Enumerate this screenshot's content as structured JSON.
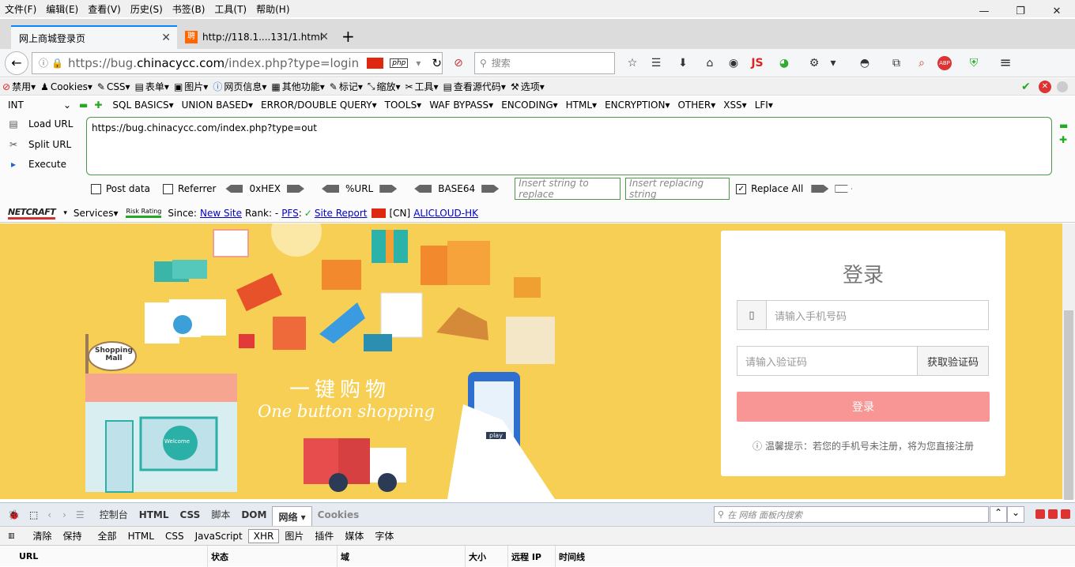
{
  "menubar": {
    "items": [
      "文件(F)",
      "编辑(E)",
      "查看(V)",
      "历史(S)",
      "书签(B)",
      "工具(T)",
      "帮助(H)"
    ]
  },
  "window": {
    "minimize": "—",
    "restore": "❐",
    "close": "✕"
  },
  "tabs": [
    {
      "title": "网上商城登录页"
    },
    {
      "title": "http://118.1....131/1.html"
    }
  ],
  "nav": {
    "url_prefix": "https://bug.",
    "url_domain": "chinacycc.com",
    "url_path": "/index.php?type=login",
    "search_placeholder": "搜索",
    "js_label": "JS",
    "php_label": "php"
  },
  "webdev": {
    "items": [
      "禁用▾",
      "Cookies▾",
      "CSS▾",
      "表单▾",
      "图片▾",
      "网页信息▾",
      "其他功能▾",
      "标记▾",
      "缩放▾",
      "工具▾",
      "查看源代码▾",
      "选项▾"
    ]
  },
  "hackbar": {
    "type_select": "INT",
    "menus": [
      "SQL BASICS▾",
      "UNION BASED▾",
      "ERROR/DOUBLE QUERY▾",
      "TOOLS▾",
      "WAF BYPASS▾",
      "ENCODING▾",
      "HTML▾",
      "ENCRYPTION▾",
      "OTHER▾",
      "XSS▾",
      "LFI▾"
    ],
    "load_url": "Load URL",
    "split_url": "Split URL",
    "execute": "Execute",
    "url_value": "https://bug.chinacycc.com/index.php?type=out",
    "post_data": "Post data",
    "referrer": "Referrer",
    "hex": "0xHEX",
    "url_enc": "%URL",
    "base64": "BASE64",
    "insert_placeholder": "Insert string to replace",
    "replacing_placeholder": "Insert replacing string",
    "replace_all": "Replace All",
    "replace_all_checked": true
  },
  "netcraft": {
    "logo": "NETCRAFT",
    "services": "Services▾",
    "risk": "Risk Rating",
    "since": "Since:",
    "since_val": "New Site",
    "rank": "Rank: -",
    "pfs": "PFS",
    "pfs_check": "✓",
    "site_report": "Site Report",
    "country": "[CN]",
    "host": "ALICLOUD-HK"
  },
  "page": {
    "slogan_cn": "一键购物",
    "slogan_en": "One button shopping",
    "mall_sign": "Shopping Mall",
    "welcome": "Welcome",
    "play": "play",
    "login": {
      "title": "登录",
      "phone_placeholder": "请输入手机号码",
      "code_placeholder": "请输入验证码",
      "get_code": "获取验证码",
      "submit": "登录",
      "tip": "温馨提示：若您的手机号未注册，将为您直接注册"
    }
  },
  "firebug": {
    "tabs": [
      "控制台",
      "HTML",
      "CSS",
      "脚本",
      "DOM",
      "网络 ▾",
      "Cookies"
    ],
    "selected_tab": "网络 ▾",
    "search_placeholder": "在 网络 面板内搜索",
    "filters": [
      "清除",
      "保持",
      "全部",
      "HTML",
      "CSS",
      "JavaScript",
      "XHR",
      "图片",
      "插件",
      "媒体",
      "字体"
    ],
    "selected_filter": "XHR",
    "columns": [
      "URL",
      "状态",
      "域",
      "大小",
      "远程 IP",
      "时间线"
    ]
  },
  "colors": {
    "accent": "#0a84ff",
    "banner": "#f7cf55",
    "login_btn": "#f89595",
    "hackbar_green": "#4a9a4a"
  }
}
